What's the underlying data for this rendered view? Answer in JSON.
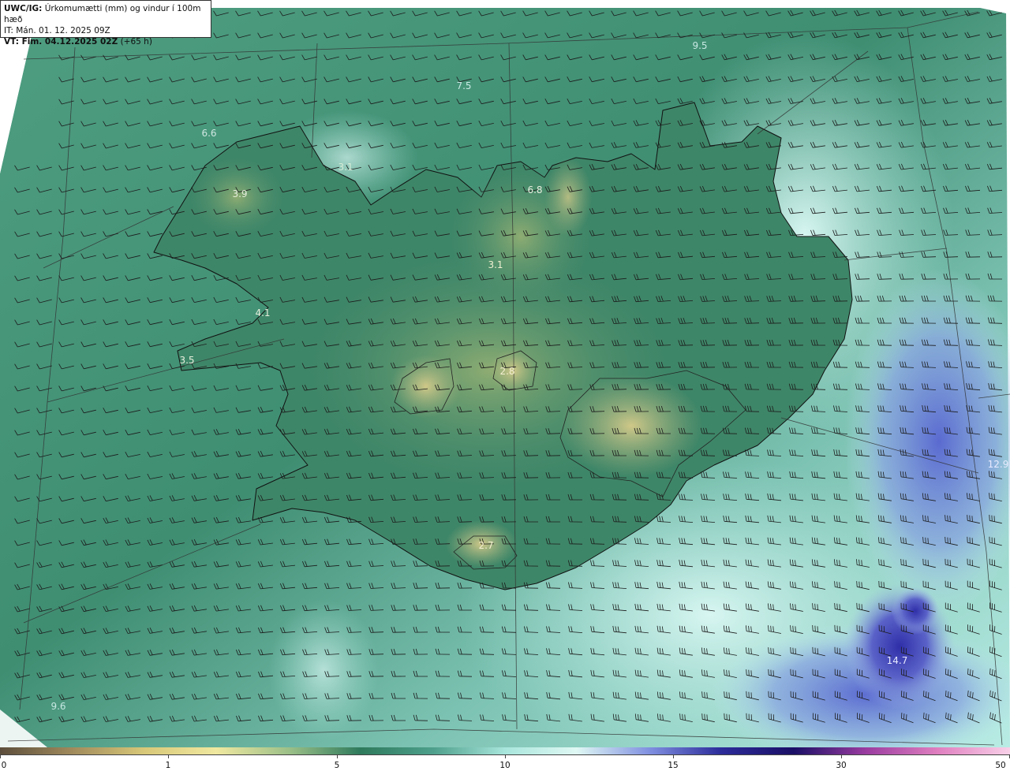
{
  "header": {
    "line1_bold": "UWC/IG:",
    "line1_text": " Úrkomumætti (mm) og vindur í 100m hæð",
    "line2": "IT: Mán. 01. 12. 2025 09Z",
    "line3_bold": "VT: Fim. 04.12.2025 02Z",
    "line3_text": " (+65 h)"
  },
  "point_values": [
    {
      "label": "9.5",
      "color": "#c8e8e2"
    },
    {
      "label": "7.5",
      "color": "#c8e8e2"
    },
    {
      "label": "6.6",
      "color": "#cfe6e0"
    },
    {
      "label": "3.1",
      "color": "#d7ecd8"
    },
    {
      "label": "6.8",
      "color": "#e8eee0"
    },
    {
      "label": "3.9",
      "color": "#e6eedc"
    },
    {
      "label": "3.1",
      "color": "#f0f0d0"
    },
    {
      "label": "4.1",
      "color": "#e6eedc"
    },
    {
      "label": "3.5",
      "color": "#e6eedc"
    },
    {
      "label": "2.8",
      "color": "#f4efd0"
    },
    {
      "label": "12.9",
      "color": "#e8eaff"
    },
    {
      "label": "2.7",
      "color": "#f4efd0"
    },
    {
      "label": "14.7",
      "color": "#e8eaff"
    },
    {
      "label": "9.6",
      "color": "#c8e8e2"
    }
  ],
  "colorbar": {
    "ticks": [
      "0",
      "1",
      "5",
      "10",
      "15",
      "30",
      "50"
    ],
    "colors": [
      "#5c4e3c",
      "#a08a5c",
      "#d8c878",
      "#f0e8a0",
      "#9cc088",
      "#2e7a5c",
      "#4ea08c",
      "#a8e6dc",
      "#e0f8f4",
      "#8090e0",
      "#2c2c9a",
      "#1a0f66",
      "#9a3ca0",
      "#e080c0",
      "#f8d0e8"
    ]
  }
}
